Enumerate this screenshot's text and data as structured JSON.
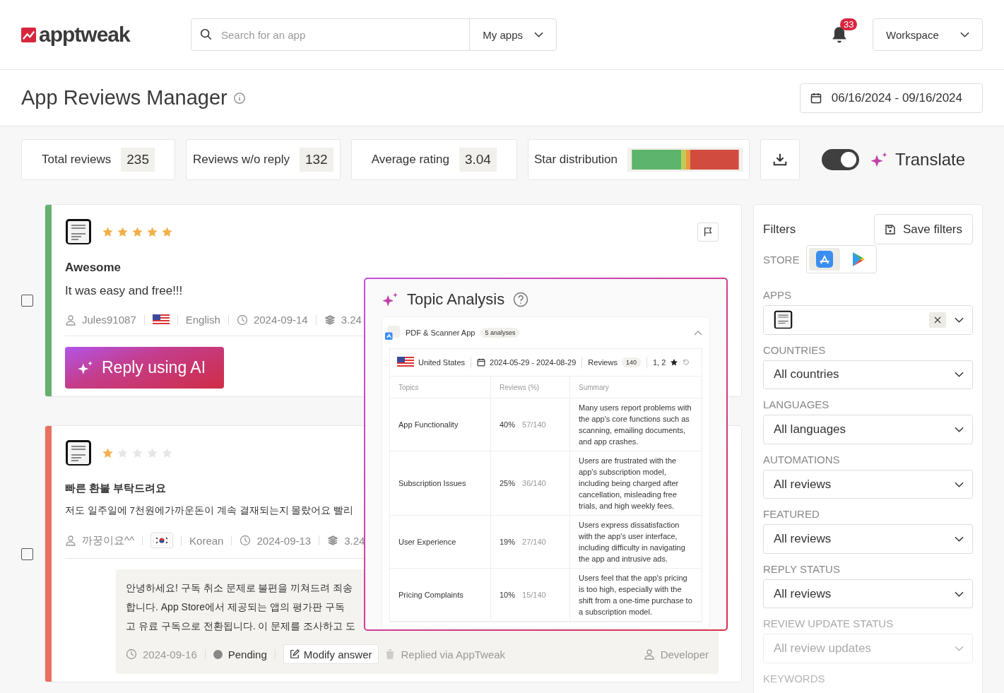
{
  "header": {
    "logo": "apptweak",
    "search": {
      "placeholder": "Search for an app"
    },
    "my_apps": "My apps",
    "notifications": "33",
    "workspace": "Workspace"
  },
  "page": {
    "title": "App Reviews Manager",
    "date_range": "06/16/2024 - 09/16/2024"
  },
  "stats": [
    {
      "label": "Total reviews",
      "value": "235"
    },
    {
      "label": "Reviews w/o reply",
      "value": "132"
    },
    {
      "label": "Average rating",
      "value": "3.04"
    }
  ],
  "star_distribution": {
    "label": "Star distribution"
  },
  "translate": {
    "on": true,
    "label": "Translate"
  },
  "reviews": [
    {
      "checked": false,
      "color": "#66b06f",
      "stars": 5,
      "title": "Awesome",
      "body": "It was easy and free!!!",
      "author": "Jules91087",
      "flag": {
        "kind": "us"
      },
      "language": "English",
      "date": "2024-09-14",
      "version": "3.24",
      "reply_button": "Reply using AI"
    },
    {
      "checked": false,
      "color": "#e8705f",
      "stars": 1,
      "title": "빠른 환불 부탁드려요",
      "body": "저도 일주일에 7천원에가까운돈이 계속 결재되는지 몰랐어요 빨리",
      "author": "까꿍이요^^",
      "flag": {
        "kind": "kr"
      },
      "language": "Korean",
      "date": "2024-09-13",
      "version": "3.24",
      "reply": {
        "text": "안녕하세요! 구독 취소 문제로 불편을 끼쳐드려 죄송\n합니다. App Store에서 제공되는 앱의 평가판 구독\n고 유료 구독으로 전환됩니다. 이 문제를 조사하고 도",
        "date": "2024-09-16",
        "status": "Pending",
        "modify": "Modify answer",
        "via": "Replied via AppTweak",
        "author": "Developer"
      }
    }
  ],
  "topic_analysis": {
    "title": "Topic Analysis",
    "app": {
      "name": "PDF & Scanner App",
      "badge": "5 analyses",
      "expanded": true
    },
    "country": "United States",
    "date_range": "2024-05-29 - 2024-08-29",
    "reviews_label": "Reviews",
    "reviews_count": "140",
    "ratings": "1, 2",
    "columns": [
      "Topics",
      "Reviews (%)",
      "Summary"
    ],
    "rows": [
      {
        "topic": "App Functionality",
        "percent": "40%",
        "count": "57/140",
        "summary": "Many users report problems with the app's core functions such as scanning, emailing documents, and app crashes."
      },
      {
        "topic": "Subscription Issues",
        "percent": "25%",
        "count": "36/140",
        "summary": "Users are frustrated with the app's subscription model, including being charged after cancellation, misleading free trials, and high weekly fees."
      },
      {
        "topic": "User Experience",
        "percent": "19%",
        "count": "27/140",
        "summary": "Users express dissatisfaction with the app's user interface, including difficulty in navigating the app and intrusive ads."
      },
      {
        "topic": "Pricing Complaints",
        "percent": "10%",
        "count": "15/140",
        "summary": "Users feel that the app's pricing is too high, especially with the shift from a one-time purchase to a subscription model."
      }
    ]
  },
  "filters": {
    "title": "Filters",
    "save": "Save filters",
    "store_label": "STORE",
    "stores": [
      {
        "kind": "app_store",
        "selected": true
      },
      {
        "kind": "play",
        "selected": false
      }
    ],
    "apps_label": "APPS",
    "fields": [
      {
        "label": "COUNTRIES",
        "value": "All countries",
        "disabled": false
      },
      {
        "label": "LANGUAGES",
        "value": "All languages",
        "disabled": false
      },
      {
        "label": "AUTOMATIONS",
        "value": "All reviews",
        "disabled": false
      },
      {
        "label": "FEATURED",
        "value": "All reviews",
        "disabled": false
      },
      {
        "label": "REPLY STATUS",
        "value": "All reviews",
        "disabled": false
      },
      {
        "label": "REVIEW UPDATE STATUS",
        "value": "All review updates",
        "disabled": true
      }
    ],
    "keywords_label": "KEYWORDS"
  }
}
